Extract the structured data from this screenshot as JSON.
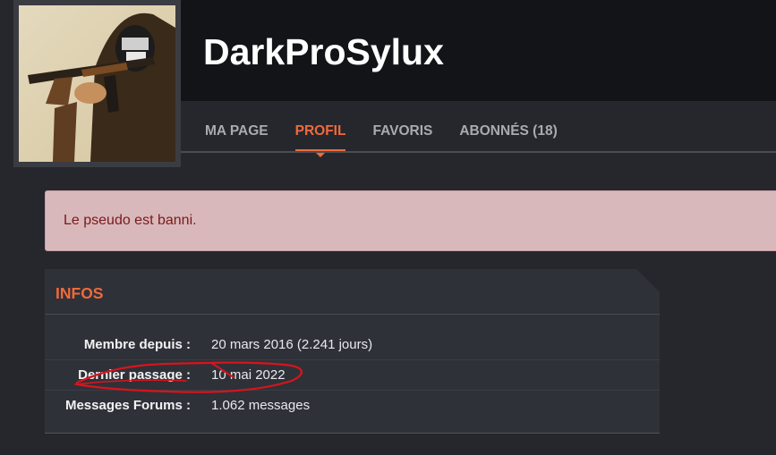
{
  "profile": {
    "username": "DarkProSylux"
  },
  "nav": {
    "tabs": [
      {
        "label": "MA PAGE"
      },
      {
        "label": "PROFIL"
      },
      {
        "label": "FAVORIS"
      },
      {
        "label": "ABONNÉS (18)"
      }
    ],
    "active_index": 1
  },
  "alert": {
    "message": "Le pseudo est banni."
  },
  "infos": {
    "title": "INFOS",
    "rows": [
      {
        "label": "Membre depuis :",
        "value": "20 mars 2016 (2.241 jours)"
      },
      {
        "label": "Dernier passage :",
        "value": "10 mai 2022"
      },
      {
        "label": "Messages Forums :",
        "value": "1.062 messages"
      }
    ]
  },
  "colors": {
    "accent": "#ef6a3c",
    "background": "#25272d",
    "header": "#131417",
    "panel": "#2f3138",
    "alert_bg": "#d9b8bc",
    "alert_text": "#7a1a1a",
    "annotation": "#d8141c"
  }
}
